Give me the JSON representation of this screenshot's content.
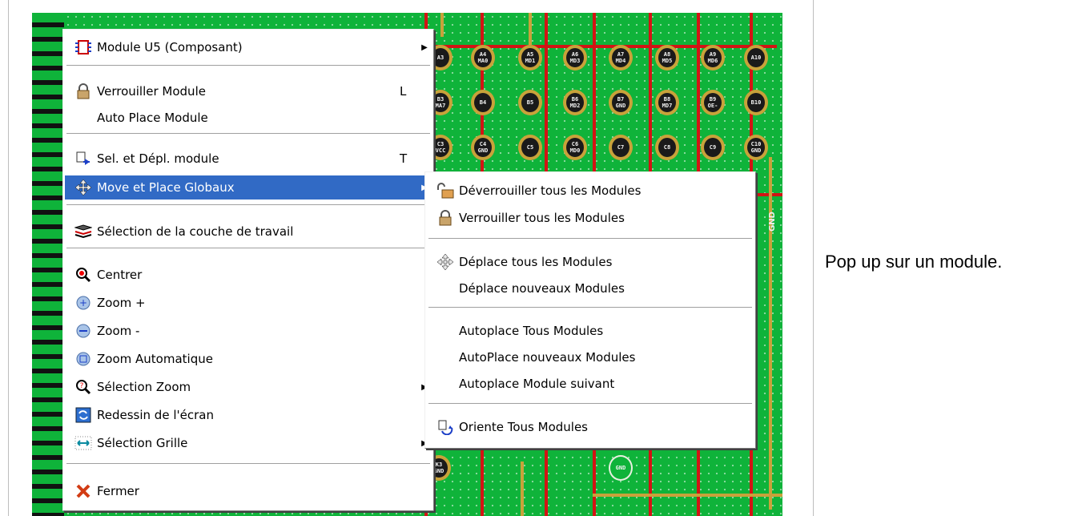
{
  "caption": "Pop up sur un module.",
  "context_menu": {
    "items": [
      {
        "label": "Module U5 (Composant)",
        "icon": "chip-icon",
        "submenu": true
      },
      {
        "label": "Verrouiller Module",
        "icon": "lock-icon",
        "shortcut": "L"
      },
      {
        "label": "Auto Place Module"
      },
      {
        "label": "Sel. et Dépl. module",
        "icon": "move-module-icon",
        "shortcut": "T"
      },
      {
        "label": "Move et Place Globaux",
        "icon": "move-arrows-icon",
        "submenu": true,
        "highlighted": true
      },
      {
        "label": "Sélection de la couche de travail",
        "icon": "layers-icon"
      },
      {
        "label": "Centrer",
        "icon": "center-zoom-icon"
      },
      {
        "label": "Zoom +",
        "icon": "zoom-in-icon"
      },
      {
        "label": "Zoom -",
        "icon": "zoom-out-icon"
      },
      {
        "label": "Zoom Automatique",
        "icon": "zoom-auto-icon"
      },
      {
        "label": "Sélection Zoom",
        "icon": "zoom-select-icon",
        "submenu": true
      },
      {
        "label": "Redessin de l'écran",
        "icon": "redraw-icon"
      },
      {
        "label": "Sélection Grille",
        "icon": "grid-icon",
        "submenu": true
      },
      {
        "label": "Fermer",
        "icon": "close-x-icon"
      }
    ]
  },
  "submenu": {
    "items": [
      {
        "label": "Déverrouiller tous les Modules",
        "icon": "unlock-icon"
      },
      {
        "label": "Verrouiller tous les Modules",
        "icon": "lock-icon"
      },
      {
        "label": "Déplace tous les Modules",
        "icon": "move-arrows-icon"
      },
      {
        "label": "Déplace nouveaux Modules"
      },
      {
        "label": "Autoplace Tous Modules"
      },
      {
        "label": "AutoPlace nouveaux Modules"
      },
      {
        "label": "Autoplace Module suivant"
      },
      {
        "label": "Oriente Tous Modules",
        "icon": "orient-icon"
      }
    ]
  },
  "pcb": {
    "pads": [
      "A3",
      "A4 MA0",
      "A5 MD1",
      "A6 MD3",
      "A7 MD4",
      "A8 MD5",
      "A9 MD6",
      "A10",
      "B3 MA7",
      "B4",
      "B5",
      "B6 MD2",
      "B7 GND",
      "B8 MD7",
      "B9 OE-",
      "B10",
      "C3 VCC",
      "C4 GND",
      "C5",
      "C6 MD0",
      "C7",
      "C8",
      "C9",
      "C10 GND",
      "K3 GND",
      "GND"
    ],
    "net_label": "GND",
    "colors": {
      "board": "#0fb33a",
      "trace_red": "#d21414",
      "trace_gold": "#c8a23a"
    }
  }
}
